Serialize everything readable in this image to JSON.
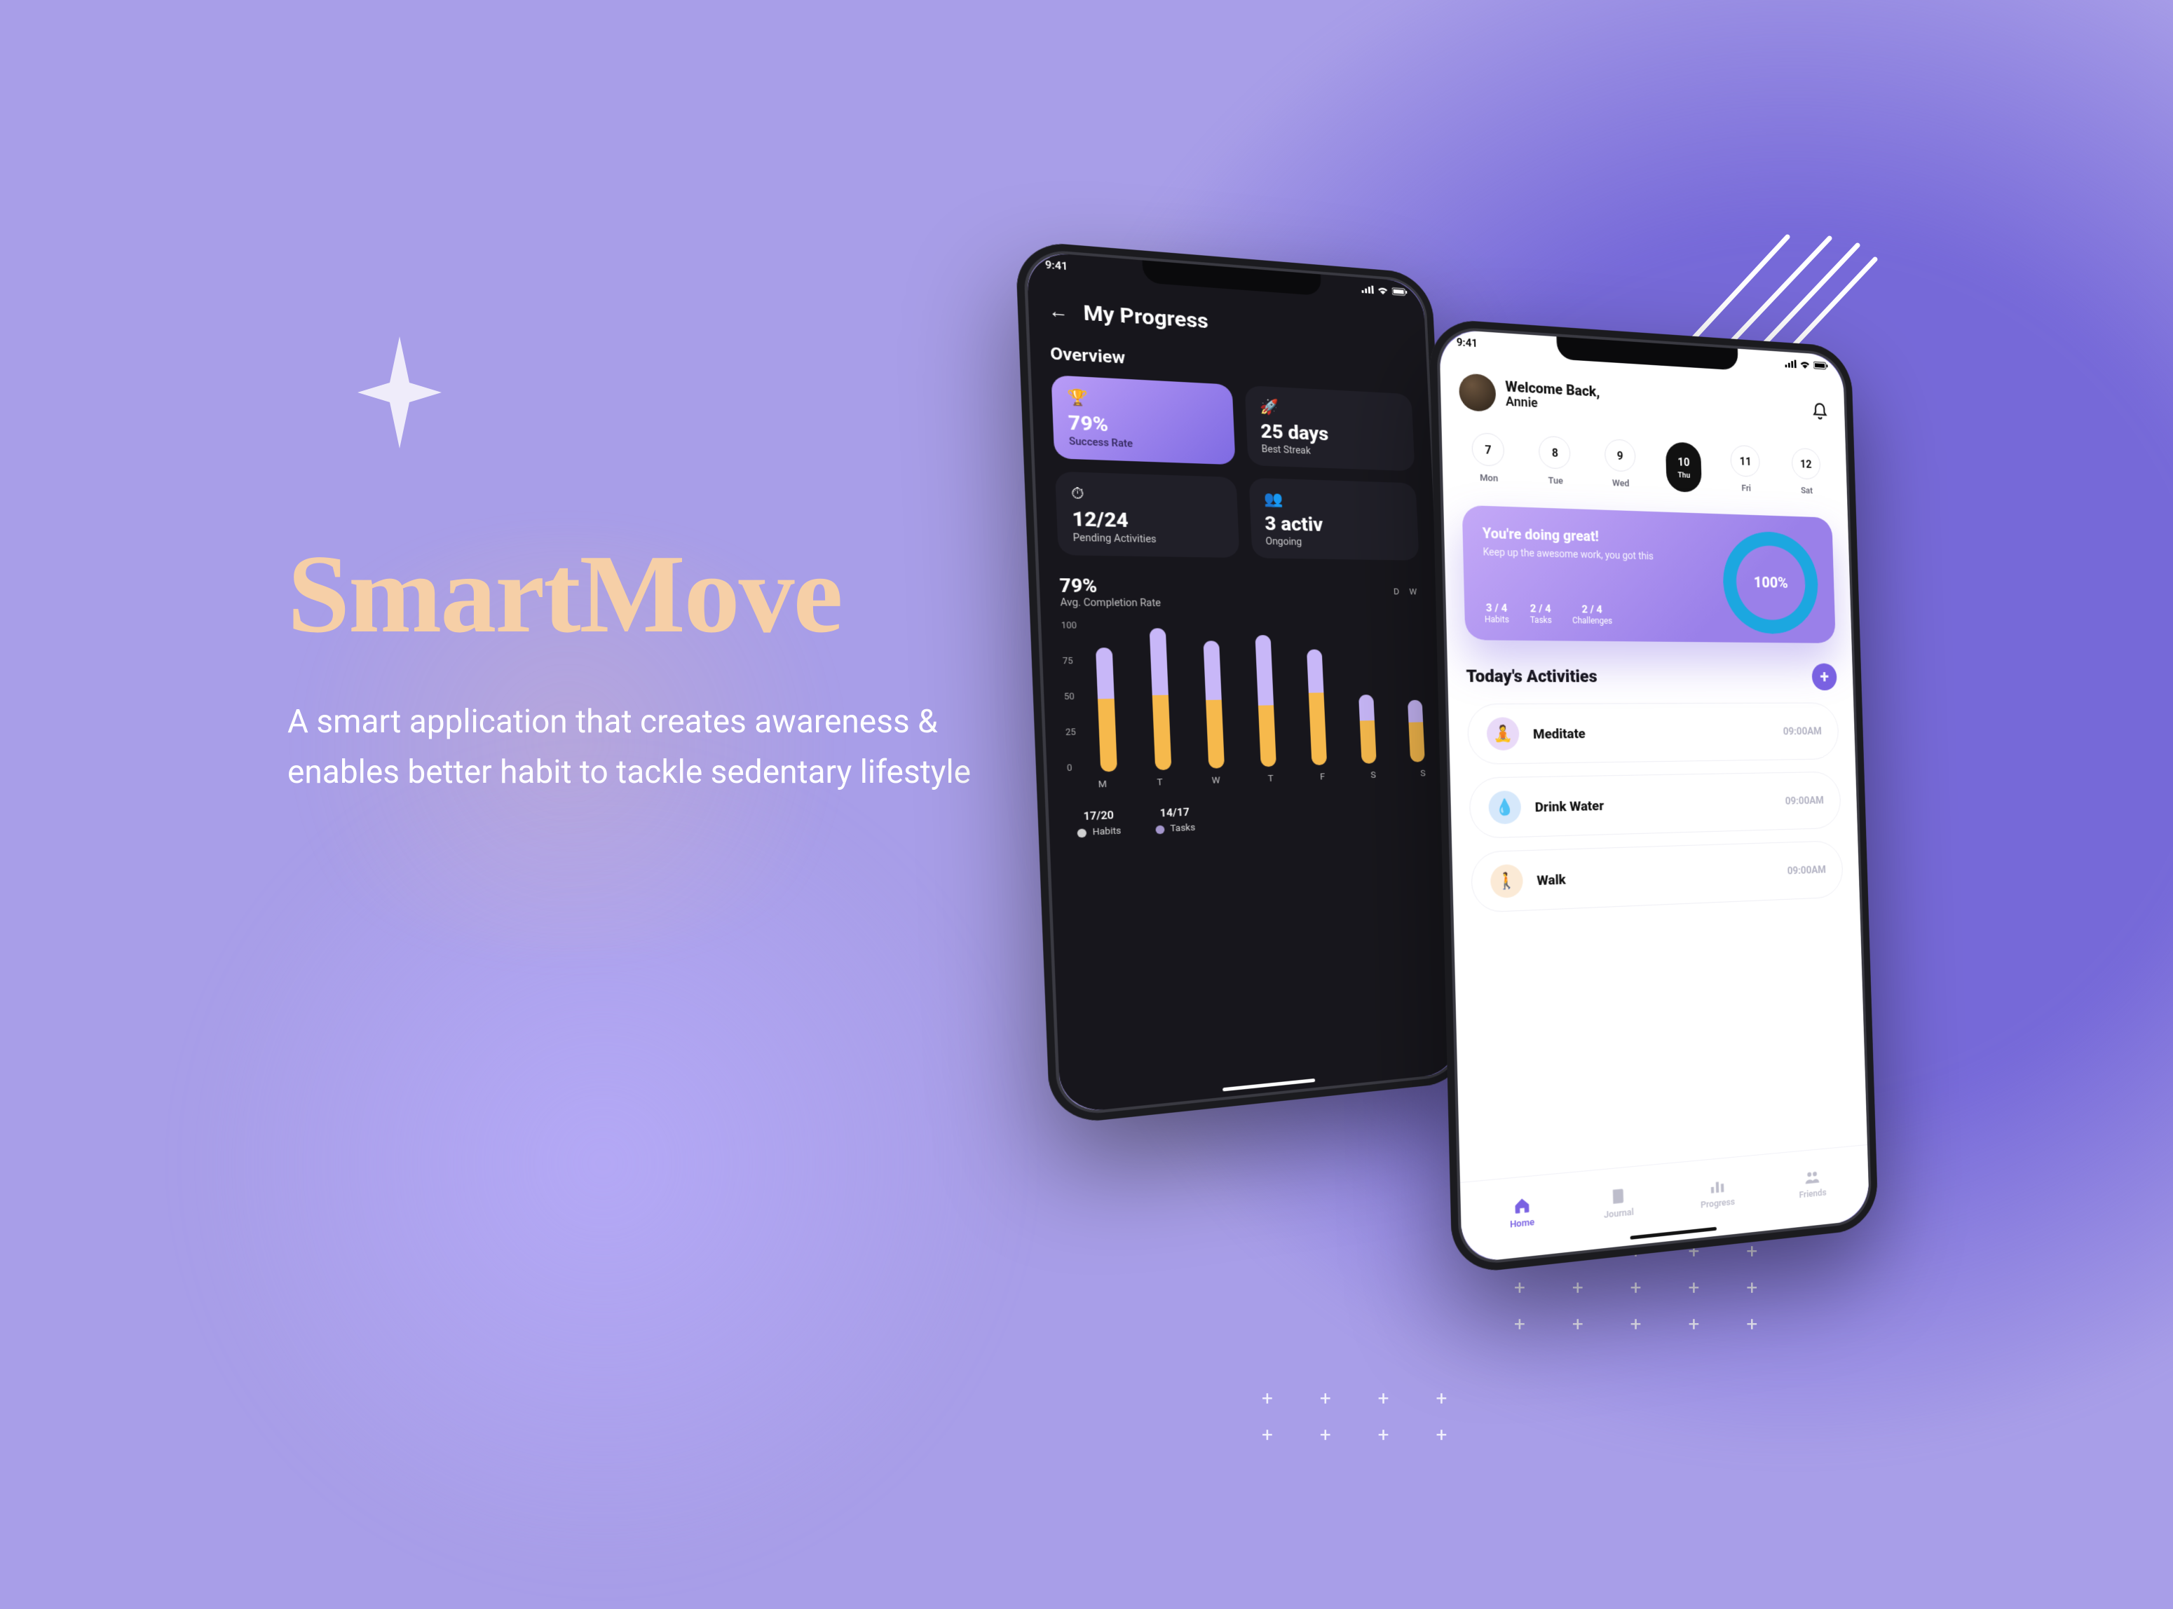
{
  "hero": {
    "title": "SmartMove",
    "tagline": "A smart application that creates awareness & enables better habit to tackle sedentary lifestyle"
  },
  "phoneA": {
    "status_time": "9:41",
    "title": "My Progress",
    "section_overview": "Overview",
    "stats": {
      "success": {
        "emoji": "🏆",
        "value": "79%",
        "label": "Success Rate"
      },
      "streak": {
        "emoji": "🚀",
        "value": "25 days",
        "label": "Best Streak"
      },
      "pending": {
        "emoji": "⏱",
        "value": "12/24",
        "label": "Pending Activities"
      },
      "ongoing": {
        "emoji": "👥",
        "value": "3 activ",
        "label": "Ongoing"
      }
    },
    "avg_section": {
      "value": "79%",
      "label": "Avg. Completion Rate",
      "range": "D  W"
    },
    "legend": {
      "habits": {
        "value": "17/20",
        "label": "Habits"
      },
      "tasks": {
        "value": "14/17",
        "label": "Tasks"
      }
    }
  },
  "chart_data": {
    "type": "bar",
    "title": "Avg. Completion Rate",
    "ylabel": "",
    "xlabel": "",
    "ylim": [
      0,
      100
    ],
    "yticks": [
      0,
      25,
      50,
      75,
      100
    ],
    "categories": [
      "M",
      "T",
      "W",
      "T",
      "F",
      "S",
      "S"
    ],
    "series": [
      {
        "name": "Habits",
        "color": "#F6B94C",
        "values": [
          48,
          50,
          46,
          42,
          50,
          30,
          28
        ]
      },
      {
        "name": "Tasks",
        "color": "#C8B7F8",
        "values": [
          34,
          45,
          40,
          48,
          30,
          18,
          16
        ]
      }
    ]
  },
  "phoneB": {
    "status_time": "9:41",
    "welcome_line1": "Welcome Back,",
    "welcome_line2": "Annie",
    "days": [
      {
        "num": "7",
        "label": "Mon",
        "selected": false
      },
      {
        "num": "8",
        "label": "Tue",
        "selected": false
      },
      {
        "num": "9",
        "label": "Wed",
        "selected": false
      },
      {
        "num": "10",
        "label": "Thu",
        "selected": true
      },
      {
        "num": "11",
        "label": "Fri",
        "selected": false
      },
      {
        "num": "12",
        "label": "Sat",
        "selected": false
      }
    ],
    "card": {
      "headline": "You're doing great!",
      "copy": "Keep up the awesome work, you got this",
      "progress": "100%",
      "minis": {
        "habits": {
          "value": "3 / 4",
          "label": "Habits"
        },
        "tasks": {
          "value": "2 / 4",
          "label": "Tasks"
        },
        "challenges": {
          "value": "2 / 4",
          "label": "Challenges"
        }
      }
    },
    "activities_title": "Today's Activities",
    "activities": [
      {
        "icon": "🧘",
        "name": "Meditate",
        "time": "09:00AM"
      },
      {
        "icon": "💧",
        "name": "Drink Water",
        "time": "09:00AM"
      },
      {
        "icon": "🚶",
        "name": "Walk",
        "time": "09:00AM"
      }
    ],
    "tabs": {
      "home": "Home",
      "journal": "Journal",
      "progress": "Progress",
      "friends": "Friends"
    }
  }
}
